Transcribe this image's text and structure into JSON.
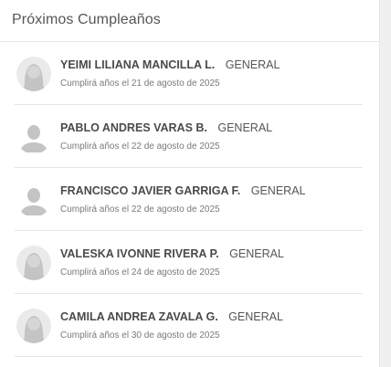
{
  "panel": {
    "title": "Próximos Cumpleaños",
    "items": [
      {
        "name": "YEIMI LILIANA MANCILLA L.",
        "group": "GENERAL",
        "date_text": "Cumplirá años el 21 de agosto de 2025",
        "avatar": "female-avatar-icon"
      },
      {
        "name": "PABLO ANDRES VARAS B.",
        "group": "GENERAL",
        "date_text": "Cumplirá años el 22 de agosto de 2025",
        "avatar": "male-avatar-icon"
      },
      {
        "name": "FRANCISCO JAVIER GARRIGA F.",
        "group": "GENERAL",
        "date_text": "Cumplirá años el 22 de agosto de 2025",
        "avatar": "male-avatar-icon"
      },
      {
        "name": "VALESKA IVONNE RIVERA P.",
        "group": "GENERAL",
        "date_text": "Cumplirá años el 24 de agosto de 2025",
        "avatar": "female-avatar-icon"
      },
      {
        "name": "CAMILA ANDREA ZAVALA G.",
        "group": "GENERAL",
        "date_text": "Cumplirá años el 30 de agosto de 2025",
        "avatar": "female-avatar-icon"
      }
    ]
  },
  "colors": {
    "title": "#555555",
    "name": "#4a4a4a",
    "date": "#7a7a7a",
    "avatar_fill": "#c4c4c4",
    "divider": "#e6e6e6"
  }
}
